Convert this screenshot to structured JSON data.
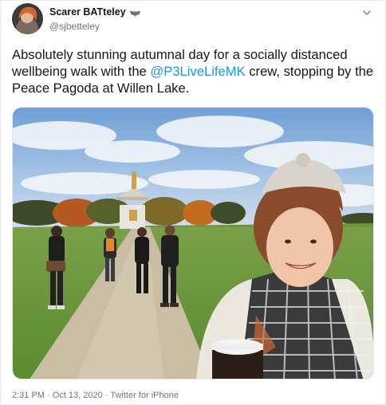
{
  "tweet": {
    "display_name": "Scarer BATteley",
    "name_emoji_icon": "bat-emoji-icon",
    "handle": "@sjbetteley",
    "text_before_mention": "Absolutely stunning autumnal day for a socially distanced wellbeing walk with the ",
    "mention": "@P3LiveLifeMK",
    "text_after_mention": " crew, stopping by the Peace Pagoda at Willen Lake.",
    "time": "2:31 PM",
    "separator": "·",
    "date": "Oct 13, 2020",
    "source": "Twitter for iPhone"
  },
  "colors": {
    "link": "#1b95e0",
    "secondary_text": "#657786",
    "primary_text": "#14171a"
  },
  "icons": {
    "more": "chevron-down-icon"
  }
}
